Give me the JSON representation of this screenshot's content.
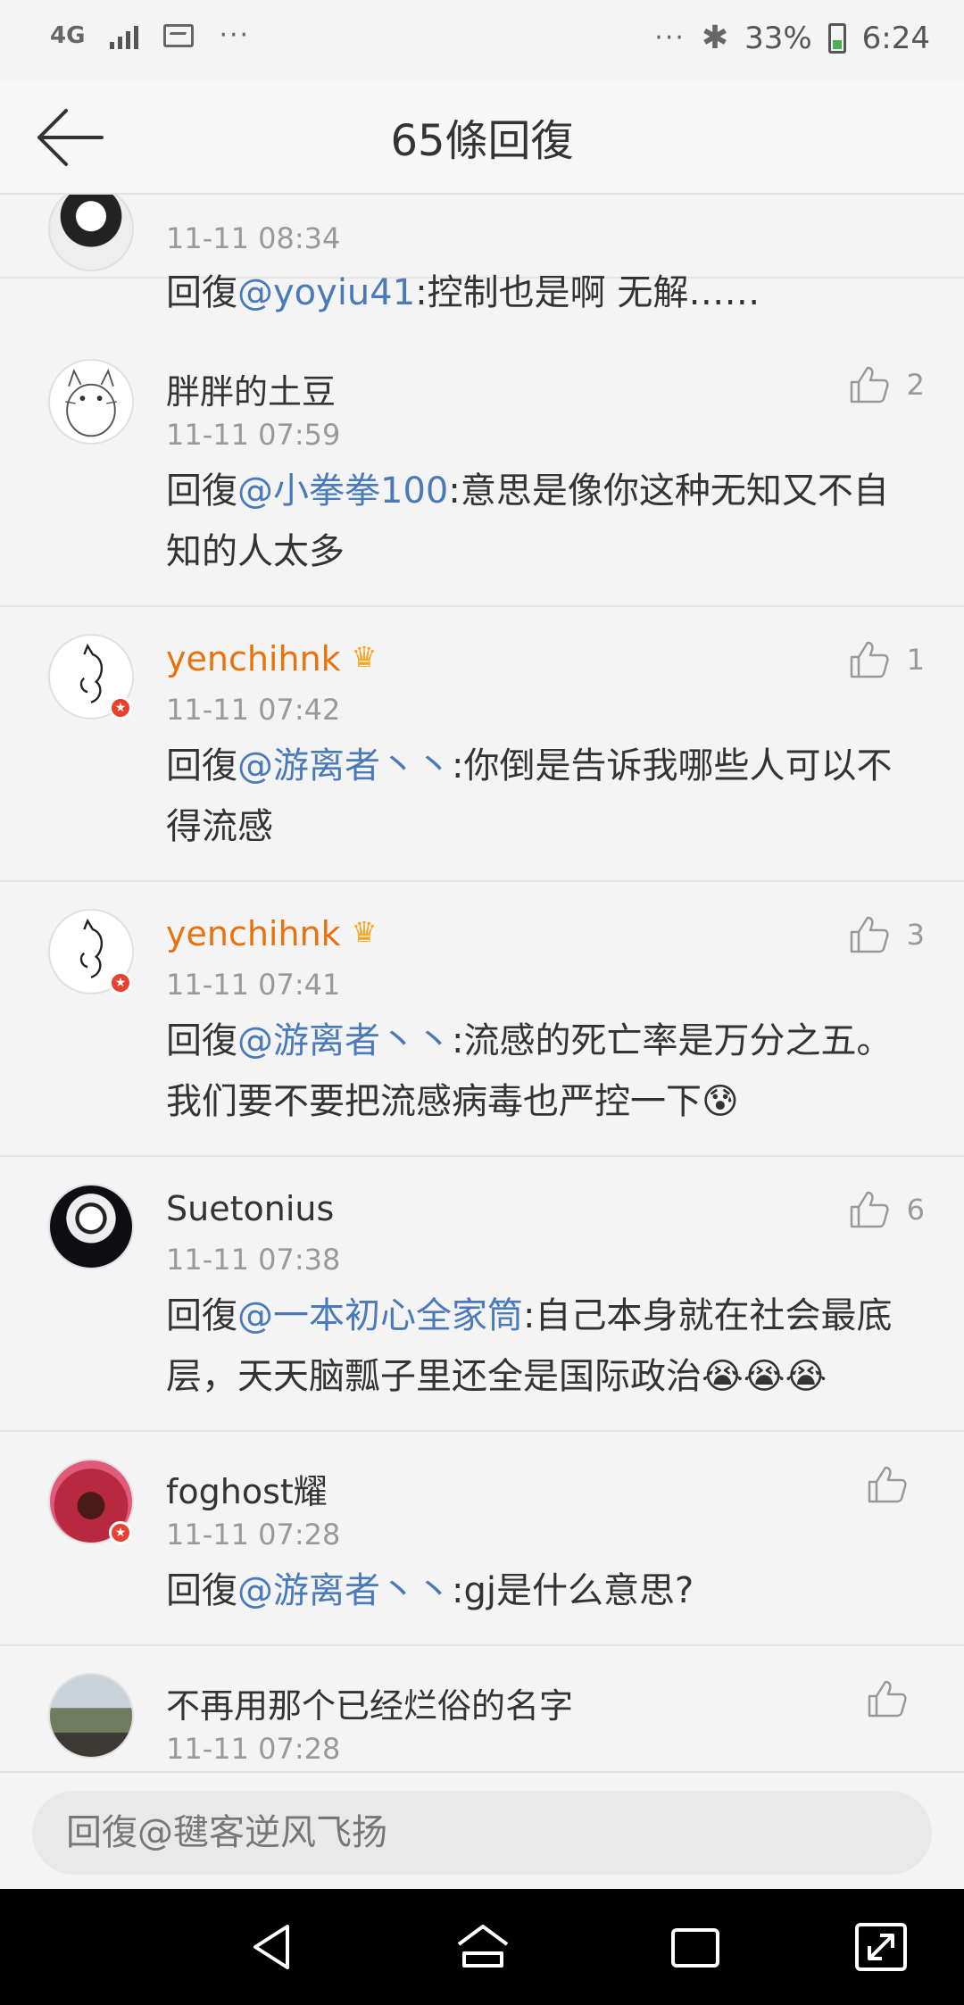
{
  "status_bar": {
    "network": "4G",
    "more": "···",
    "battery_pct": "33%",
    "time": "6:24",
    "battery_level": 0.33
  },
  "header": {
    "title": "65條回復",
    "back_icon": "back-arrow-icon"
  },
  "comments": [
    {
      "name": "",
      "time": "11-11 08:34",
      "reply_prefix": "回復",
      "mention": "@yoyiu41",
      "text": ":控制也是啊 无解……",
      "likes": "",
      "vip": false
    },
    {
      "name": "胖胖的土豆",
      "time": "11-11 07:59",
      "reply_prefix": "回復",
      "mention": "@小拳拳100",
      "text": ":意思是像你这种无知又不自知的人太多",
      "likes": "2",
      "vip": false
    },
    {
      "name": "yenchihnk",
      "time": "11-11 07:42",
      "reply_prefix": "回復",
      "mention": "@游离者丶丶",
      "text": ":你倒是告诉我哪些人可以不得流感",
      "likes": "1",
      "vip": true
    },
    {
      "name": "yenchihnk",
      "time": "11-11 07:41",
      "reply_prefix": "回復",
      "mention": "@游离者丶丶",
      "text": ":流感的死亡率是万分之五。我们要不要把流感病毒也严控一下😰",
      "likes": "3",
      "vip": true
    },
    {
      "name": "Suetonius",
      "time": "11-11 07:38",
      "reply_prefix": "回復",
      "mention": "@一本初心全家筒",
      "text": ":自己本身就在社会最底层，天天脑瓢子里还全是国际政治😭😭😭",
      "likes": "6",
      "vip": false
    },
    {
      "name": "foghost耀",
      "time": "11-11 07:28",
      "reply_prefix": "回復",
      "mention": "@游离者丶丶",
      "text": ":gj是什么意思?",
      "likes": "",
      "vip": false
    },
    {
      "name": "不再用那个已经烂俗的名字",
      "time": "11-11 07:28",
      "reply_prefix": "",
      "mention": "",
      "text": "",
      "likes": "",
      "vip": false
    }
  ],
  "input": {
    "placeholder": "回復@毽客逆风飞扬"
  },
  "colors": {
    "mention": "#4a7ab8",
    "vip_name": "#e8720c",
    "badge": "#e8412f"
  }
}
